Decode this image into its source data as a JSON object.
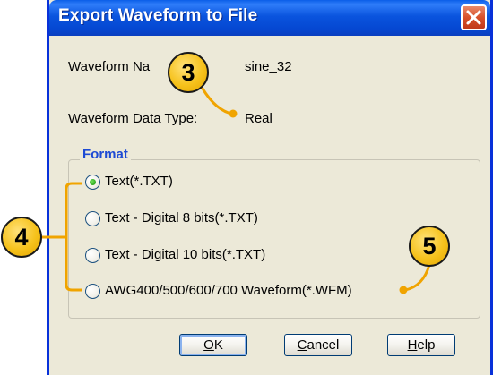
{
  "dialog": {
    "title": "Export Waveform to File",
    "close_icon": "close-icon"
  },
  "fields": {
    "name_label": "Waveform Na",
    "name_value": "sine_32",
    "type_label": "Waveform Data Type:",
    "type_value": "Real"
  },
  "format": {
    "group_title": "Format",
    "options": [
      {
        "label": "Text(*.TXT)",
        "checked": true
      },
      {
        "label": "Text - Digital 8 bits(*.TXT)",
        "checked": false
      },
      {
        "label": "Text - Digital 10 bits(*.TXT)",
        "checked": false
      },
      {
        "label": "AWG400/500/600/700 Waveform(*.WFM)",
        "checked": false
      }
    ]
  },
  "buttons": {
    "ok_underlined": "O",
    "ok_rest": "K",
    "cancel_underlined": "C",
    "cancel_rest": "ancel",
    "help_underlined": "H",
    "help_rest": "elp"
  },
  "callouts": {
    "c3": "3",
    "c4": "4",
    "c5": "5"
  },
  "colors": {
    "titlebar": "#0a54de",
    "callout_fill": "#f6c21c",
    "leader_line": "#f0a400",
    "group_title": "#1e4bd4",
    "radio_selected": "#2ea81e"
  }
}
